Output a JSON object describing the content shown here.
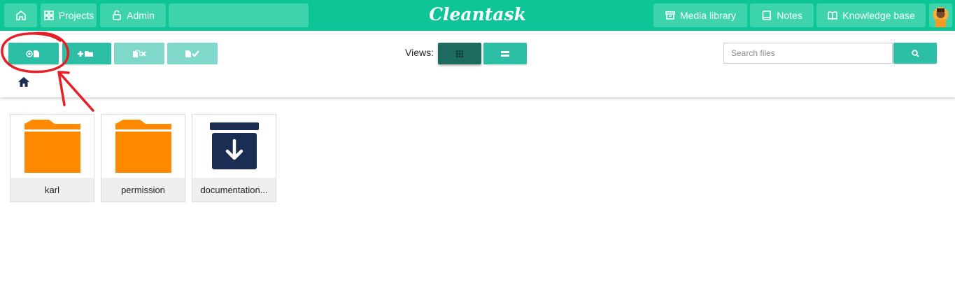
{
  "nav": {
    "projects_label": "Projects",
    "admin_label": "Admin",
    "brand": "Cleantask",
    "media_library_label": "Media library",
    "notes_label": "Notes",
    "knowledge_base_label": "Knowledge base"
  },
  "toolbar": {
    "upload_icon": "upload-file-icon",
    "new_folder_icon": "add-folder-icon",
    "delete_icon": "delete-files-icon",
    "select_icon": "select-files-icon",
    "views_label": "Views:",
    "view_grid_icon": "grid-icon",
    "view_list_icon": "list-icon"
  },
  "search": {
    "placeholder": "Search files"
  },
  "files": [
    {
      "name": "karl",
      "type": "folder"
    },
    {
      "name": "permission",
      "type": "folder"
    },
    {
      "name": "documentation...",
      "type": "archive"
    }
  ],
  "colors": {
    "brand": "#0ec597",
    "button": "#2dbea6",
    "folder": "#ff8a00",
    "archive": "#1b2d52",
    "annotation": "#e81e25"
  }
}
